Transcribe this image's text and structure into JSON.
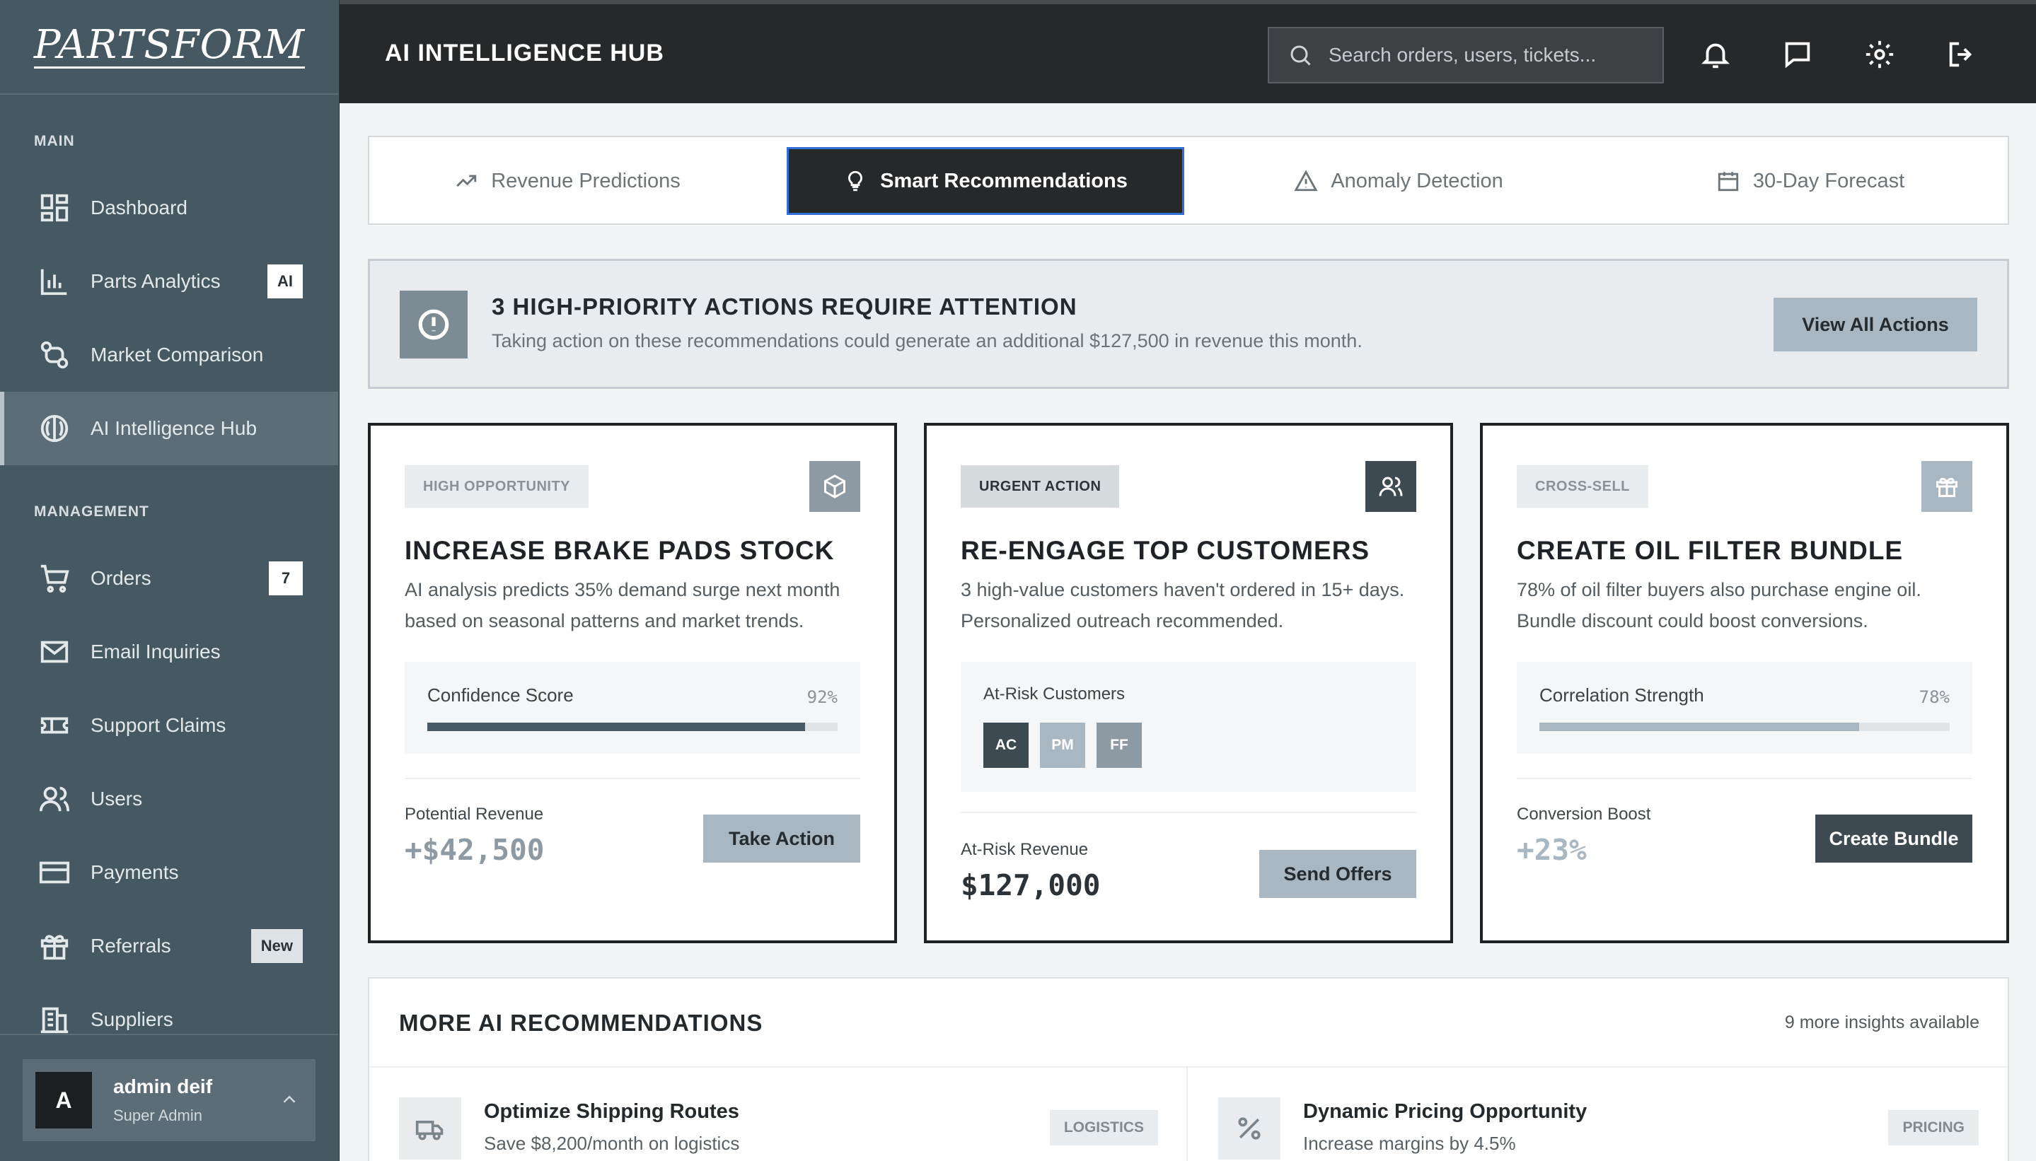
{
  "brand": {
    "logo_text": "PARTSFORM"
  },
  "sidebar": {
    "sections": {
      "main": "MAIN",
      "management": "MANAGEMENT"
    },
    "items": [
      {
        "label": "Dashboard",
        "icon": "dashboard-icon"
      },
      {
        "label": "Parts Analytics",
        "icon": "bar-chart-icon",
        "badge": "AI"
      },
      {
        "label": "Market Comparison",
        "icon": "compare-icon"
      },
      {
        "label": "AI Intelligence Hub",
        "icon": "brain-icon",
        "active": true
      },
      {
        "label": "Orders",
        "icon": "cart-icon",
        "badge": "7"
      },
      {
        "label": "Email Inquiries",
        "icon": "mail-icon"
      },
      {
        "label": "Support Claims",
        "icon": "ticket-icon"
      },
      {
        "label": "Users",
        "icon": "users-icon"
      },
      {
        "label": "Payments",
        "icon": "credit-card-icon"
      },
      {
        "label": "Referrals",
        "icon": "gift-icon",
        "badge": "New"
      },
      {
        "label": "Suppliers",
        "icon": "building-icon"
      }
    ],
    "user": {
      "initial": "A",
      "name": "admin deif",
      "role": "Super Admin"
    }
  },
  "header": {
    "title": "AI INTELLIGENCE HUB",
    "search_placeholder": "Search orders, users, tickets...",
    "icons": [
      "bell-icon",
      "chat-icon",
      "gear-icon",
      "logout-icon"
    ]
  },
  "tabs": [
    {
      "label": "Revenue Predictions",
      "icon": "trending-up-icon"
    },
    {
      "label": "Smart Recommendations",
      "icon": "lightbulb-icon",
      "active": true
    },
    {
      "label": "Anomaly Detection",
      "icon": "warning-icon"
    },
    {
      "label": "30-Day Forecast",
      "icon": "calendar-icon"
    }
  ],
  "alert": {
    "title": "3 HIGH-PRIORITY ACTIONS REQUIRE ATTENTION",
    "text": "Taking action on these recommendations could generate an additional $127,500 in revenue this month.",
    "button": "View All Actions"
  },
  "cards": [
    {
      "badge": "HIGH OPPORTUNITY",
      "icon": "box-icon",
      "title": "INCREASE BRAKE PADS STOCK",
      "desc": "AI analysis predicts 35% demand surge next month based on seasonal patterns and market trends.",
      "metric_label": "Confidence Score",
      "metric_value": "92%",
      "metric_fraction": 0.92,
      "revenue_label": "Potential Revenue",
      "revenue_value": "+$42,500",
      "button": "Take Action"
    },
    {
      "badge": "URGENT ACTION",
      "icon": "users-icon",
      "title": "RE-ENGAGE TOP CUSTOMERS",
      "desc": "3 high-value customers haven't ordered in 15+ days. Personalized outreach recommended.",
      "metric_label": "At-Risk Customers",
      "chips": [
        "AC",
        "PM",
        "FF"
      ],
      "revenue_label": "At-Risk Revenue",
      "revenue_value": "$127,000",
      "button": "Send Offers"
    },
    {
      "badge": "CROSS-SELL",
      "icon": "gift-icon",
      "title": "CREATE OIL FILTER BUNDLE",
      "desc": "78% of oil filter buyers also purchase engine oil. Bundle discount could boost conversions.",
      "metric_label": "Correlation Strength",
      "metric_value": "78%",
      "metric_fraction": 0.78,
      "revenue_label": "Conversion Boost",
      "revenue_value": "+23%",
      "button": "Create Bundle"
    }
  ],
  "more": {
    "title": "MORE AI RECOMMENDATIONS",
    "count": "9 more insights available",
    "items": [
      {
        "icon": "truck-icon",
        "title": "Optimize Shipping Routes",
        "sub": "Save $8,200/month on logistics",
        "tag": "LOGISTICS"
      },
      {
        "icon": "percent-icon",
        "title": "Dynamic Pricing Opportunity",
        "sub": "Increase margins by 4.5%",
        "tag": "PRICING"
      }
    ]
  },
  "colors": {
    "sidebar": "#465862",
    "header": "#262829",
    "accent_dark": "#3d4a52",
    "accent_light": "#a8b7c2"
  }
}
